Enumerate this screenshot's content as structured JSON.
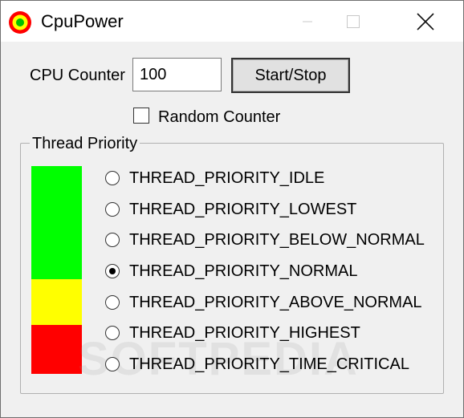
{
  "window": {
    "title": "CpuPower"
  },
  "titlebar": {
    "icon": "app-target-icon",
    "minimize_icon": "minimize-icon",
    "maximize_icon": "maximize-icon",
    "close_icon": "close-icon"
  },
  "controls": {
    "cpu_counter_label": "CPU Counter",
    "cpu_counter_value": "100",
    "start_stop_label": "Start/Stop",
    "random_counter_label": "Random Counter",
    "random_counter_checked": false
  },
  "thread_priority": {
    "group_label": "Thread Priority",
    "selected": "THREAD_PRIORITY_NORMAL",
    "options": [
      {
        "label": "THREAD_PRIORITY_IDLE",
        "checked": false
      },
      {
        "label": "THREAD_PRIORITY_LOWEST",
        "checked": false
      },
      {
        "label": "THREAD_PRIORITY_BELOW_NORMAL",
        "checked": false
      },
      {
        "label": "THREAD_PRIORITY_NORMAL",
        "checked": true
      },
      {
        "label": "THREAD_PRIORITY_ABOVE_NORMAL",
        "checked": false
      },
      {
        "label": "THREAD_PRIORITY_HIGHEST",
        "checked": false
      },
      {
        "label": "THREAD_PRIORITY_TIME_CRITICAL",
        "checked": false
      }
    ],
    "indicator_colors": {
      "low": "#00ff00",
      "mid": "#ffff00",
      "high": "#ff0000"
    }
  },
  "watermark": "SOFTPEDIA"
}
